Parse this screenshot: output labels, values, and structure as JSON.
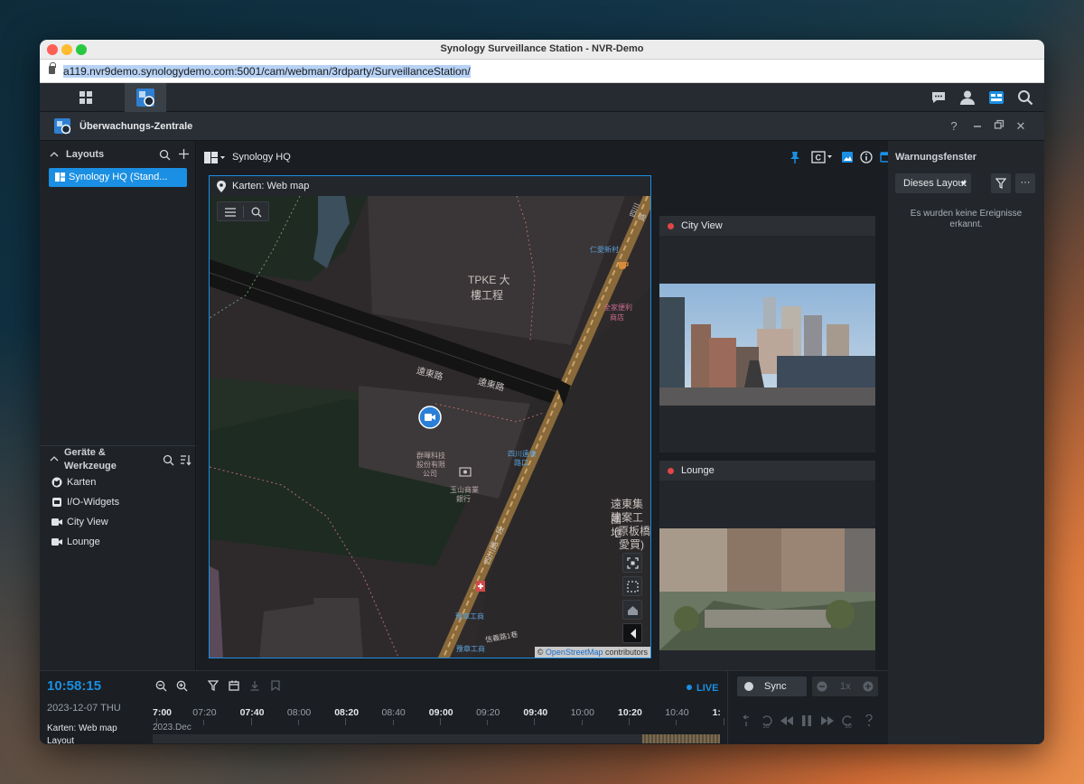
{
  "window": {
    "title": "Synology Surveillance Station - NVR-Demo",
    "url": "a119.nvr9demo.synologydemo.com:5001/cam/webman/3rdparty/SurveillanceStation/"
  },
  "app": {
    "title": "Überwachungs-Zentrale",
    "help": "?",
    "close": "✕"
  },
  "sidebar": {
    "layouts_heading": "Layouts",
    "layout_selected": "Synology HQ (Stand...",
    "devices_heading_1": "Geräte &",
    "devices_heading_2": "Werkzeuge",
    "devices": [
      {
        "label": "Karten",
        "icon": "map-icon"
      },
      {
        "label": "I/O-Widgets",
        "icon": "io-widget-icon"
      },
      {
        "label": "City View",
        "icon": "camera-icon"
      },
      {
        "label": "Lounge",
        "icon": "camera-icon"
      }
    ]
  },
  "toolbar": {
    "layout_name": "Synology HQ"
  },
  "map_pane": {
    "title": "Karten: Web map",
    "attribution_prefix": "© ",
    "attribution_link": "OpenStreetMap",
    "attribution_suffix": " contributors",
    "labels": {
      "building": "TPKE 大",
      "building2": "樓工程",
      "road1": "遠東路",
      "road2": "遠東路",
      "store1": "全家便利",
      "store2": "商店",
      "poi1": "群暉科技",
      "poi2": "股份有限",
      "poi3": "公司",
      "bank1": "玉山商業",
      "bank2": "銀行",
      "stop1": "四川遠東",
      "stop2": "路口",
      "site1": "遠東集團",
      "site2": "建案工地",
      "site3": "(原板橋",
      "site4": "愛買)",
      "road3": "四川路一段",
      "road4": "信義路1巷",
      "stop3": "仁愛新村",
      "stop4": "豫章工商",
      "stop5": "豫章工商",
      "road5": "四川路"
    }
  },
  "cameras": [
    {
      "name": "City View"
    },
    {
      "name": "Lounge"
    }
  ],
  "warn_panel": {
    "title": "Warnungsfenster",
    "filter_label": "Dieses Layout",
    "more": "···",
    "empty_message_1": "Es wurden keine Ereignisse",
    "empty_message_2": "erkannt."
  },
  "timeline": {
    "clock": "10:58:15",
    "date": "2023-12-07 THU",
    "live": "LIVE",
    "track1": "Karten: Web map",
    "track2": "Layout",
    "month": "2023.Dec",
    "ticks": [
      {
        "label": "7:00",
        "bold": true
      },
      {
        "label": "07:20",
        "bold": false
      },
      {
        "label": "07:40",
        "bold": true
      },
      {
        "label": "08:00",
        "bold": false
      },
      {
        "label": "08:20",
        "bold": true
      },
      {
        "label": "08:40",
        "bold": false
      },
      {
        "label": "09:00",
        "bold": true
      },
      {
        "label": "09:20",
        "bold": false
      },
      {
        "label": "09:40",
        "bold": true
      },
      {
        "label": "10:00",
        "bold": false
      },
      {
        "label": "10:20",
        "bold": true
      },
      {
        "label": "10:40",
        "bold": false
      },
      {
        "label": "1:",
        "bold": true
      }
    ],
    "sync": "Sync",
    "speed": "1x"
  },
  "colors": {
    "accent": "#1a8fe3",
    "record": "#e04646"
  }
}
